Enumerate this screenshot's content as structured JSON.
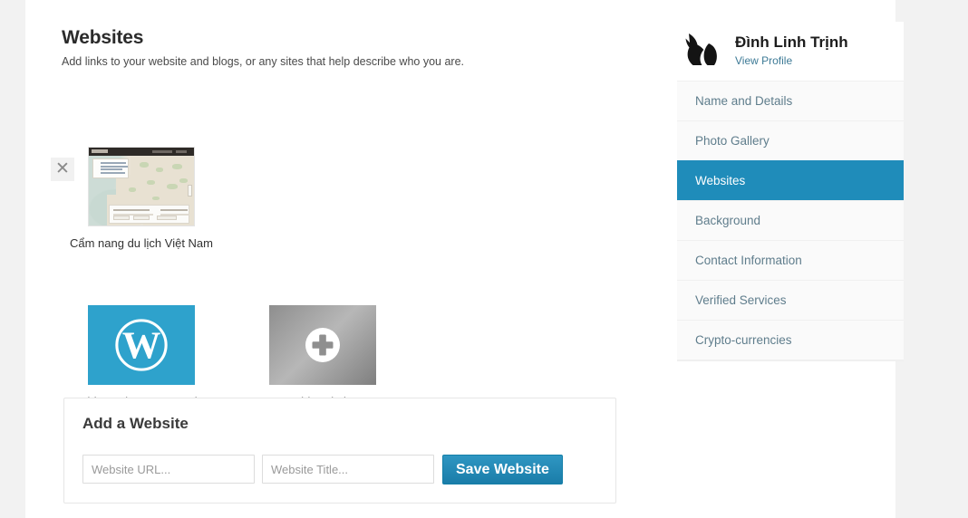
{
  "main": {
    "title": "Websites",
    "description": "Add links to your website and blogs, or any sites that help describe who you are.",
    "remove_icon": "close-icon",
    "remove_glyph": "✕",
    "sites": [
      {
        "caption": "Cẩm nang du lịch Việt Nam",
        "type": "thumbnail"
      },
      {
        "caption": "Add WordPress.com Site",
        "type": "wordpress",
        "icon": "wordpress-icon",
        "color": "#2ea2cc"
      },
      {
        "caption": "Add Website",
        "type": "add",
        "icon": "plus-circle-icon"
      }
    ]
  },
  "add_form": {
    "title": "Add a Website",
    "url_value": "",
    "url_placeholder": "Website URL...",
    "title_value": "",
    "title_placeholder": "Website Title...",
    "save_label": "Save Website"
  },
  "sidebar": {
    "profile": {
      "name": "Đình Linh Trịnh",
      "link_label": "View Profile",
      "avatar_icon": "fox-avatar-icon"
    },
    "items": [
      {
        "label": "Name and Details",
        "active": false
      },
      {
        "label": "Photo Gallery",
        "active": false
      },
      {
        "label": "Websites",
        "active": true
      },
      {
        "label": "Background",
        "active": false
      },
      {
        "label": "Contact Information",
        "active": false
      },
      {
        "label": "Verified Services",
        "active": false
      },
      {
        "label": "Crypto-currencies",
        "active": false
      }
    ]
  },
  "colors": {
    "accent": "#1f8cba",
    "wordpress_blue": "#2ea2cc",
    "page_background": "#f2f2f2",
    "sheet_background": "#ffffff",
    "link": "#3d7a96"
  }
}
